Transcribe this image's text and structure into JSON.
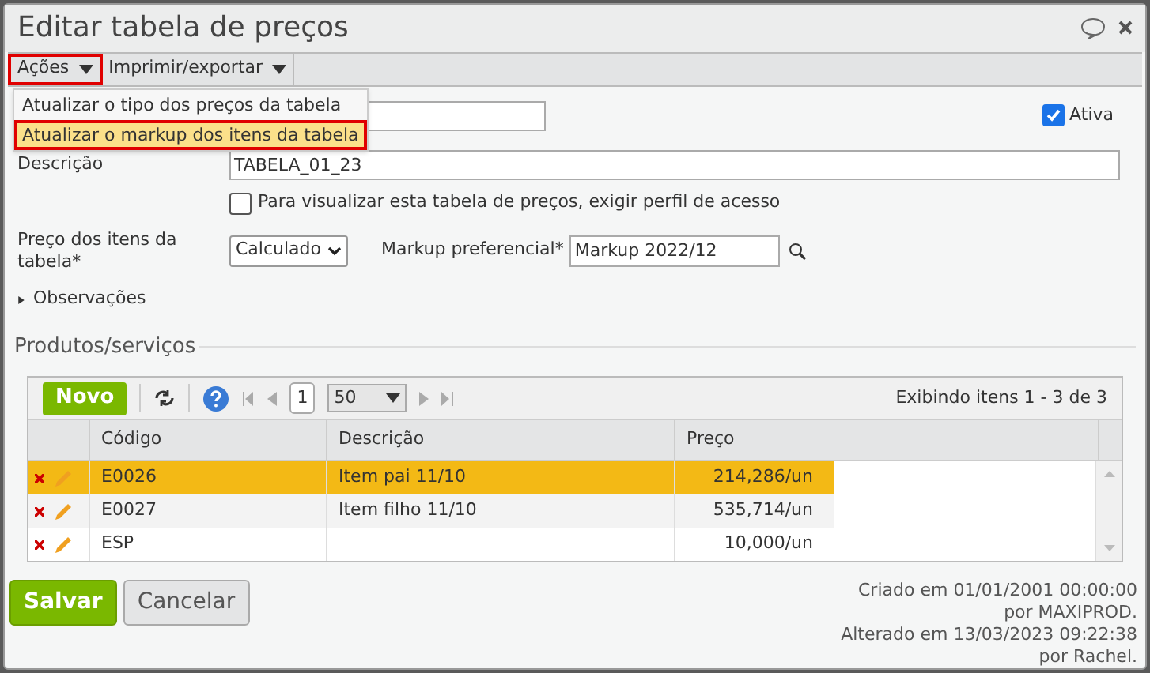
{
  "window": {
    "title": "Editar tabela de preços"
  },
  "toolbar": [
    {
      "label": "Ações",
      "highlighted": true
    },
    {
      "label": "Imprimir/exportar",
      "highlighted": false
    }
  ],
  "menu": [
    {
      "label": "Atualizar o tipo dos preços da tabela",
      "selected": false,
      "highlighted": false
    },
    {
      "label": "Atualizar o markup dos itens da tabela",
      "selected": true,
      "highlighted": true
    }
  ],
  "form": {
    "ativa": {
      "label": "Ativa",
      "checked": true
    },
    "descricao": {
      "label": "Descrição",
      "value": "TABELA_01_23"
    },
    "perfil": {
      "label": "Para visualizar esta tabela de preços, exigir perfil de acesso",
      "checked": false
    },
    "preco": {
      "label": "Preço dos itens da tabela*",
      "value": "Calculado"
    },
    "markup": {
      "label": "Markup preferencial*",
      "value": "Markup 2022/12"
    },
    "observacoes": {
      "label": "Observações",
      "expanded": false
    }
  },
  "section": {
    "title": "Produtos/serviços"
  },
  "grid": {
    "new_button": "Novo",
    "page": "1",
    "page_size": "50",
    "summary": "Exibindo itens 1 - 3 de 3",
    "columns": [
      "Código",
      "Descrição",
      "Preço"
    ],
    "rows": [
      {
        "codigo": "E0026",
        "descricao": "Item pai 11/10",
        "preco": "214,286/un",
        "selected": true
      },
      {
        "codigo": "E0027",
        "descricao": "Item filho 11/10",
        "preco": "535,714/un",
        "selected": false
      },
      {
        "codigo": "ESP",
        "descricao": "",
        "preco": "10,000/un",
        "selected": false
      }
    ]
  },
  "buttons": {
    "save": "Salvar",
    "cancel": "Cancelar"
  },
  "audit": [
    "Criado em 01/01/2001 00:00:00",
    "por MAXIPROD.",
    "Alterado em 13/03/2023 09:22:38",
    "por Rachel."
  ]
}
